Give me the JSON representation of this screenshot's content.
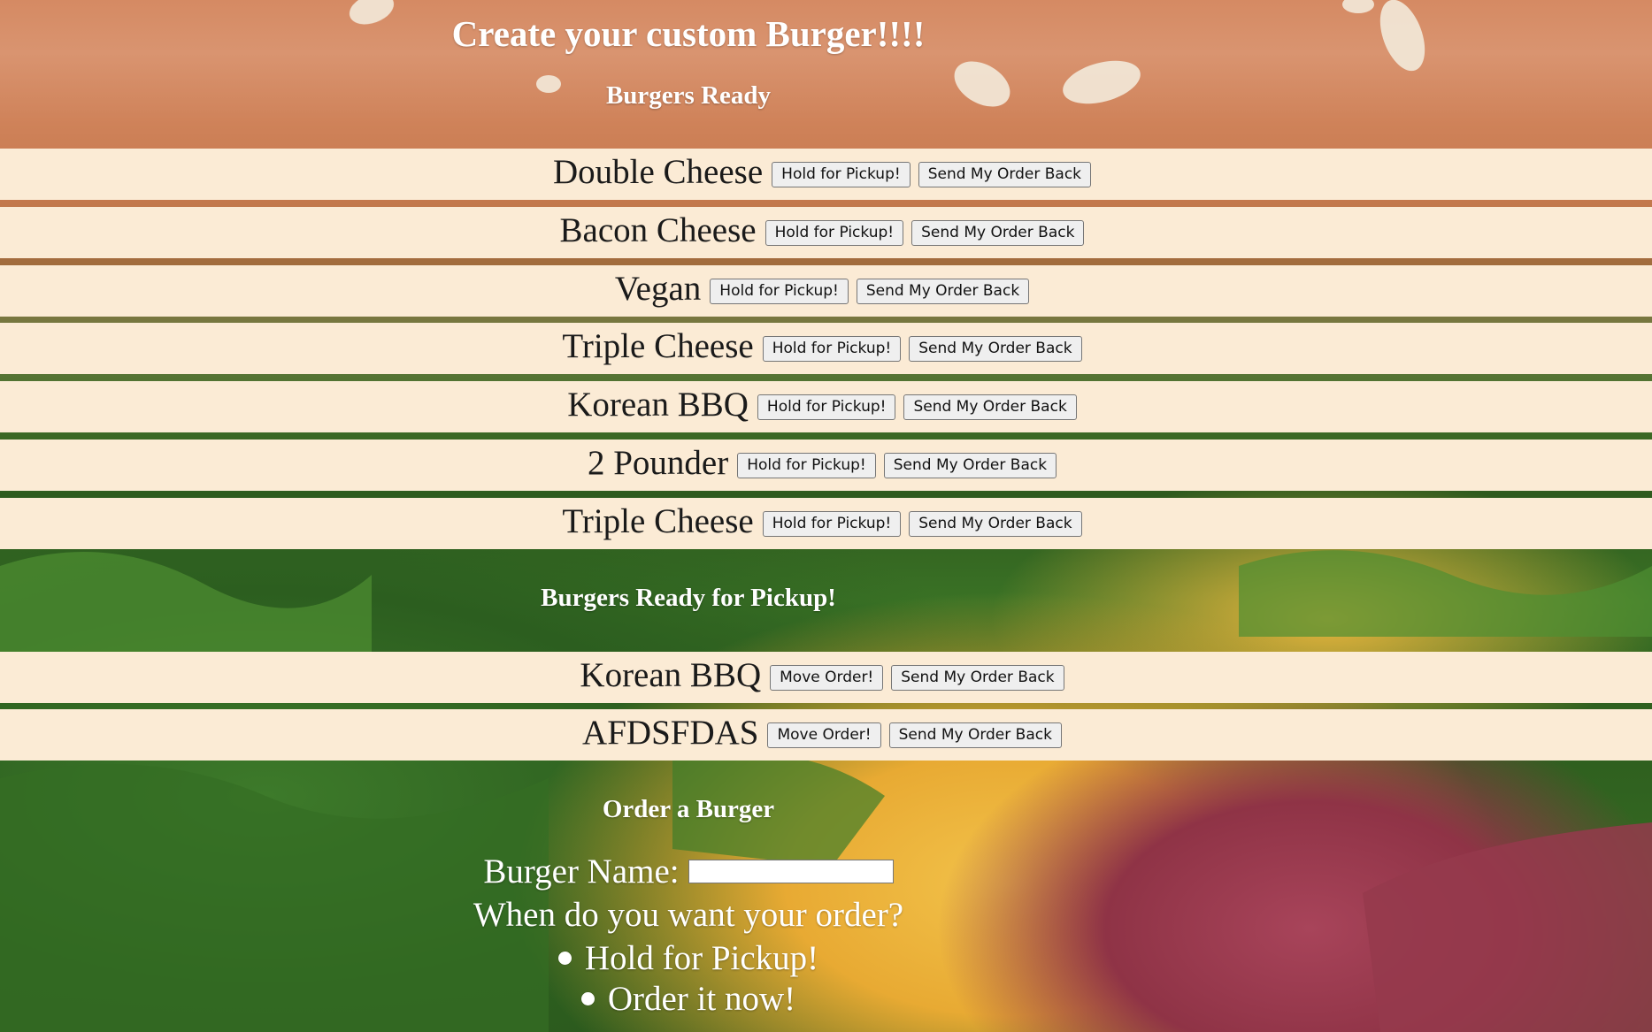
{
  "page_title": "Create your custom Burger!!!!",
  "ready_section": {
    "heading": "Burgers Ready",
    "items": [
      {
        "name": "Double Cheese",
        "hold_label": "Hold for Pickup!",
        "send_label": "Send My Order Back"
      },
      {
        "name": "Bacon Cheese",
        "hold_label": "Hold for Pickup!",
        "send_label": "Send My Order Back"
      },
      {
        "name": "Vegan",
        "hold_label": "Hold for Pickup!",
        "send_label": "Send My Order Back"
      },
      {
        "name": "Triple Cheese",
        "hold_label": "Hold for Pickup!",
        "send_label": "Send My Order Back"
      },
      {
        "name": "Korean BBQ",
        "hold_label": "Hold for Pickup!",
        "send_label": "Send My Order Back"
      },
      {
        "name": "2 Pounder",
        "hold_label": "Hold for Pickup!",
        "send_label": "Send My Order Back"
      },
      {
        "name": "Triple Cheese",
        "hold_label": "Hold for Pickup!",
        "send_label": "Send My Order Back"
      }
    ]
  },
  "pickup_section": {
    "heading": "Burgers Ready for Pickup!",
    "items": [
      {
        "name": "Korean BBQ",
        "move_label": "Move Order!",
        "send_label": "Send My Order Back"
      },
      {
        "name": "AFDSFDAS",
        "move_label": "Move Order!",
        "send_label": "Send My Order Back"
      }
    ]
  },
  "order_form": {
    "heading": "Order a Burger",
    "name_label": "Burger Name:",
    "name_value": "",
    "question": "When do you want your order?",
    "options": [
      {
        "label": "Hold for Pickup!"
      },
      {
        "label": "Order it now!"
      }
    ]
  },
  "colors": {
    "row_background": "#fbebd5",
    "heading_text": "#ffffff"
  }
}
